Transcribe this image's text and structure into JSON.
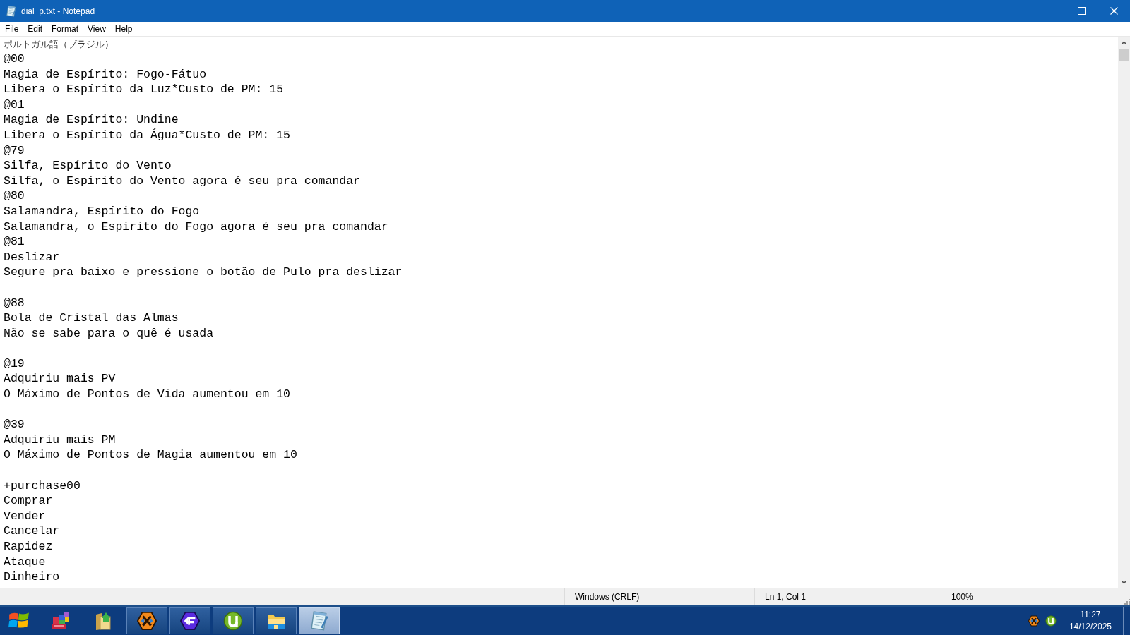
{
  "window": {
    "title": "dial_p.txt - Notepad"
  },
  "menu": [
    "File",
    "Edit",
    "Format",
    "View",
    "Help"
  ],
  "document": {
    "header": "ポルトガル語（ブラジル）",
    "paragraphs": [
      [
        "@00",
        "Magia de Espírito: Fogo-Fátuo",
        "Libera o Espírito da Luz*Custo de PM: 15",
        "@01",
        "Magia de Espírito: Undine",
        "Libera o Espírito da Água*Custo de PM: 15",
        "@79",
        "Silfa, Espírito do Vento",
        "Silfa, o Espírito do Vento agora é seu pra comandar",
        "@80",
        "Salamandra, Espírito do Fogo",
        "Salamandra, o Espírito do Fogo agora é seu pra comandar",
        "@81",
        "Deslizar",
        "Segure pra baixo e pressione o botão de Pulo pra deslizar"
      ],
      [
        "@88",
        "Bola de Cristal das Almas",
        "Não se sabe para o quê é usada"
      ],
      [
        "@19",
        "Adquiriu mais PV",
        "O Máximo de Pontos de Vida aumentou em 10"
      ],
      [
        "@39",
        "Adquiriu mais PM",
        "O Máximo de Pontos de Magia aumentou em 10"
      ],
      [
        "+purchase00",
        "Comprar",
        "Vender",
        "Cancelar",
        "Rapidez",
        "Ataque",
        "Dinheiro"
      ]
    ]
  },
  "status_bar": {
    "line_ending": "Windows (CRLF)",
    "cursor": "Ln 1, Col 1",
    "zoom": "100%"
  },
  "taskbar": {
    "apps": [
      {
        "kind": "blocks",
        "running": false,
        "selected": false
      },
      {
        "kind": "folder-arrow",
        "running": false,
        "selected": false
      },
      {
        "kind": "hex-x",
        "running": true,
        "selected": false
      },
      {
        "kind": "f-logo",
        "running": true,
        "selected": false
      },
      {
        "kind": "torrent",
        "running": true,
        "selected": false
      },
      {
        "kind": "explorer",
        "running": true,
        "selected": false
      },
      {
        "kind": "notepad",
        "running": true,
        "selected": true
      }
    ],
    "tray": [
      {
        "kind": "hex-x"
      },
      {
        "kind": "torrent"
      }
    ],
    "clock": {
      "time": "11:27",
      "date": "14/12/2025"
    }
  }
}
